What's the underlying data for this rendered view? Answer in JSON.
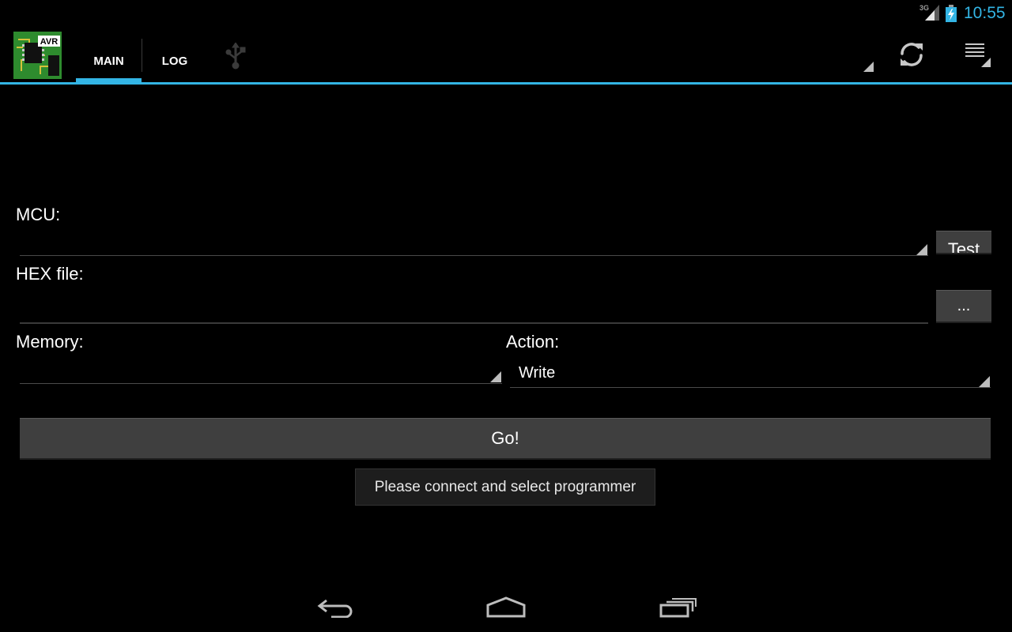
{
  "status_bar": {
    "network": "3G",
    "clock": "10:55",
    "signal_icon": "signal-icon",
    "battery_icon": "battery-charging-icon"
  },
  "action_bar": {
    "app_icon": "avr-chip-app-icon",
    "app_icon_text": "AVR",
    "tabs": [
      {
        "label": "MAIN",
        "selected": true
      },
      {
        "label": "LOG",
        "selected": false
      }
    ],
    "icons": [
      "usb-icon",
      "refresh-icon",
      "overflow-menu-icon"
    ],
    "accent_color": "#33b5e5"
  },
  "form": {
    "mcu_label": "MCU:",
    "mcu_value": "",
    "test_button": "Test",
    "hex_label": "HEX file:",
    "hex_value": "",
    "browse_button": "...",
    "memory_label": "Memory:",
    "memory_value": "",
    "action_label": "Action:",
    "action_value": "Write",
    "go_button": "Go!"
  },
  "toast": {
    "message": "Please connect and select programmer"
  },
  "nav_bar": {
    "icons": [
      "back-icon",
      "home-icon",
      "recent-apps-icon"
    ]
  }
}
